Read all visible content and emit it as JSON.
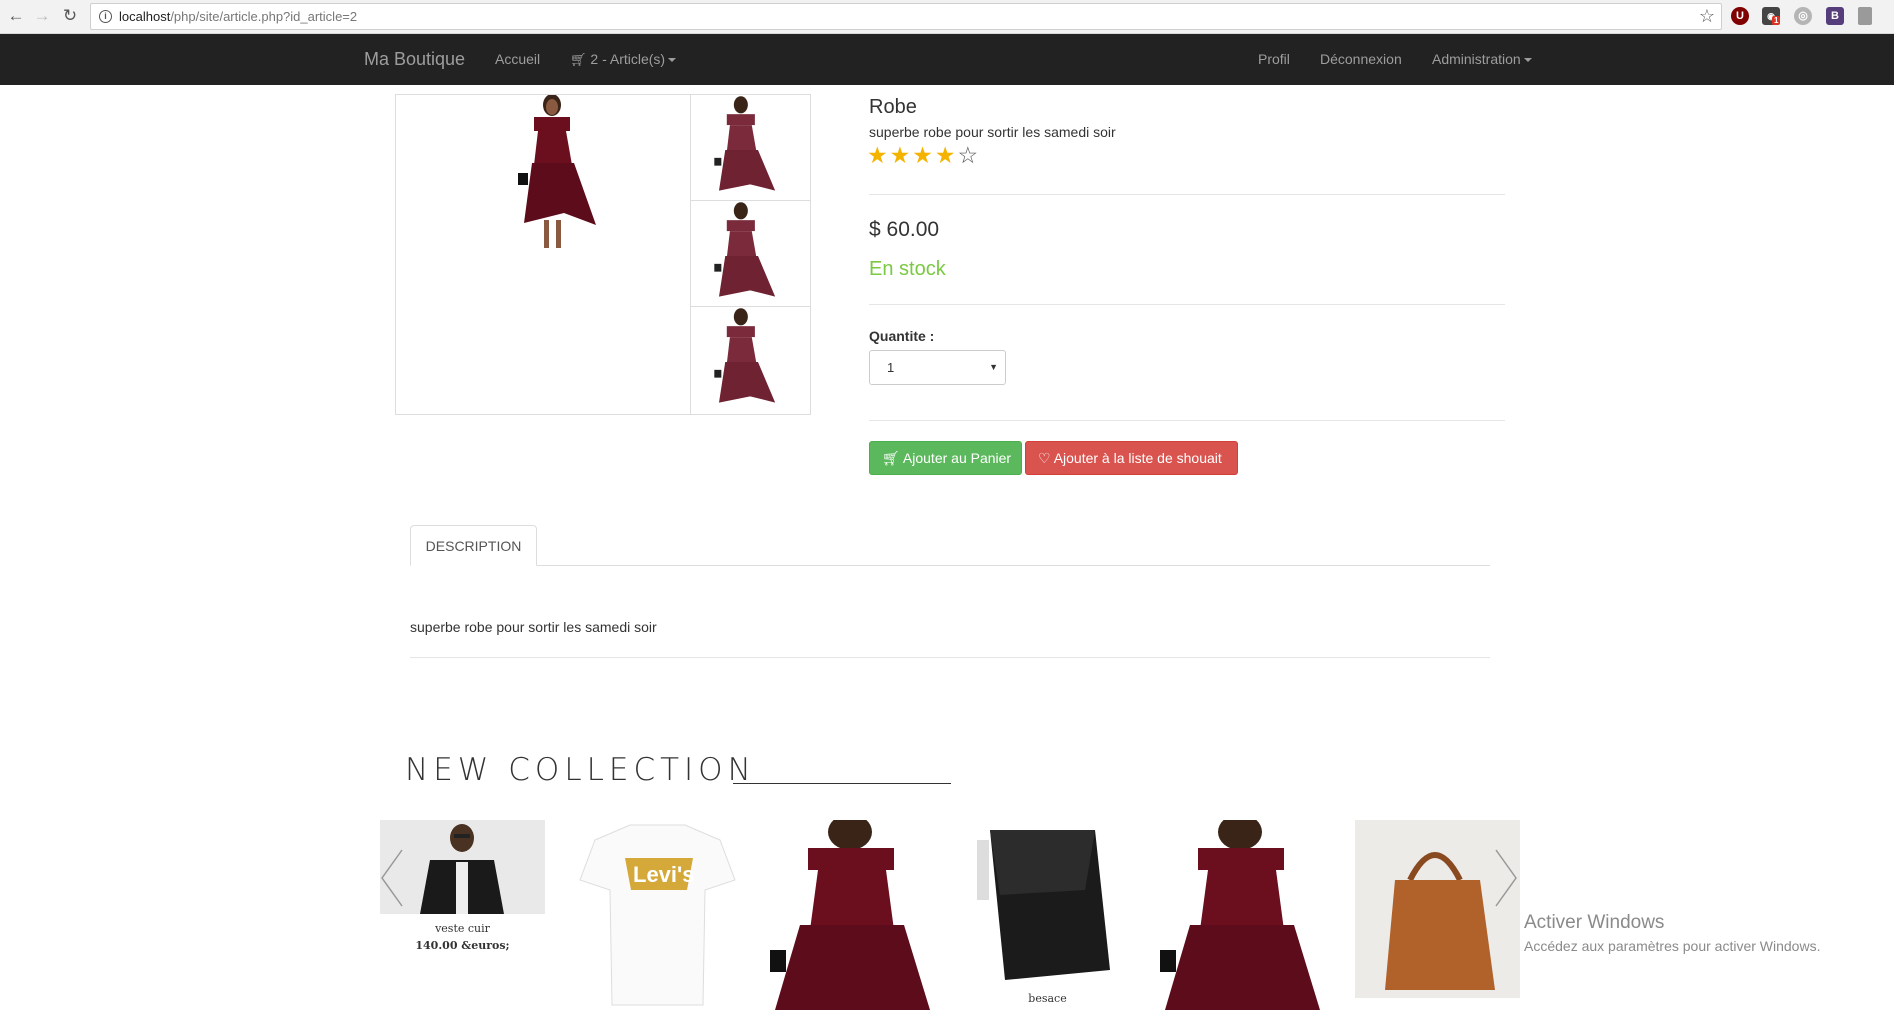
{
  "browser": {
    "url_host": "localhost",
    "url_rest": "/php/site/article.php?id_article=2",
    "extensions": [
      {
        "name": "ublock-icon",
        "glyph": "U",
        "color": "#800000"
      },
      {
        "name": "ghost-extension-icon",
        "glyph": "👤",
        "color": "#444444"
      },
      {
        "name": "speech-extension-icon",
        "glyph": "◎",
        "color": "#9a9a9a"
      },
      {
        "name": "bootstrap-extension-icon",
        "glyph": "B",
        "color": "#563d7c"
      }
    ],
    "badge": "1"
  },
  "navbar": {
    "brand": "Ma Boutique",
    "home": "Accueil",
    "cart": "2 - Article(s)",
    "profile": "Profil",
    "logout": "Déconnexion",
    "admin": "Administration"
  },
  "product": {
    "title": "Robe",
    "subtitle": "superbe robe pour sortir les samedi soir",
    "rating": 4,
    "rating_max": 5,
    "price": "$ 60.00",
    "stock": "En stock",
    "quantity_label": "Quantite :",
    "quantity_value": "1",
    "add_to_cart": "Ajouter au Panier",
    "add_to_wishlist": "Ajouter à la liste de shouait"
  },
  "tabs": {
    "description_tab": "DESCRIPTION",
    "description_text": "superbe robe pour sortir les samedi soir"
  },
  "collection": {
    "title": "NEW COLLECTION",
    "items": [
      {
        "name": "veste cuir",
        "price": "140.00 &euros;"
      },
      {
        "name": "",
        "price": ""
      },
      {
        "name": "",
        "price": ""
      },
      {
        "name": "besace",
        "price": ""
      },
      {
        "name": "",
        "price": ""
      },
      {
        "name": "",
        "price": ""
      }
    ]
  },
  "watermark": {
    "line1": "Activer Windows",
    "line2": "Accédez aux paramètres pour activer Windows."
  },
  "colors": {
    "navbar_bg": "#222222",
    "success": "#5cb85c",
    "danger": "#d9534f",
    "stock_green": "#7ac943",
    "star_gold": "#f5b301",
    "dress": "#6b0f1f"
  }
}
